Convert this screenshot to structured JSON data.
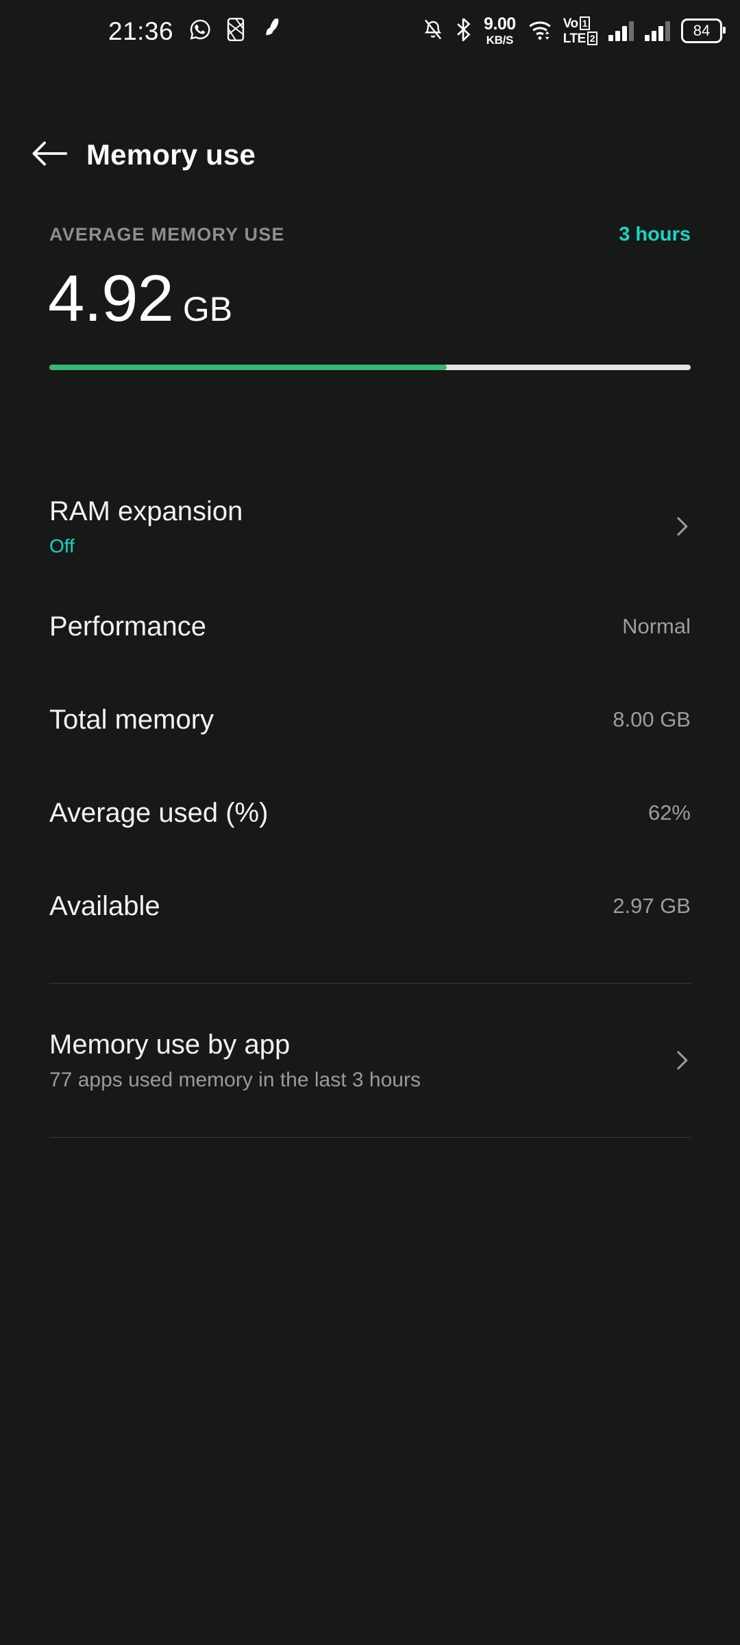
{
  "statusbar": {
    "time": "21:36",
    "left_icons": [
      "whatsapp-icon",
      "sim-card-icon",
      "location-rocket-icon"
    ],
    "right_icons": [
      "notifications-silenced-icon",
      "bluetooth-icon",
      "wifi-icon",
      "battery-icon"
    ],
    "network_speed": {
      "value": "9.00",
      "unit": "KB/S"
    },
    "volte": {
      "line1": "VoD",
      "line1_text": "Vo",
      "sim1": "1",
      "line2_text": "LTE",
      "sim2": "2"
    },
    "battery_level": "84"
  },
  "appbar": {
    "back_icon": "arrow-left-icon",
    "title": "Memory use"
  },
  "summary": {
    "label": "AVERAGE MEMORY USE",
    "period": "3 hours",
    "value": "4.92",
    "unit": "GB",
    "progress_percent": 62,
    "bar_fill_color": "#36b777",
    "bar_track_color": "#e4e4e4",
    "accent_color": "#16d6c4"
  },
  "list": {
    "ram_expansion": {
      "title": "RAM expansion",
      "subtitle": "Off",
      "chevron": "chevron-right-icon"
    },
    "details": [
      {
        "title": "Performance",
        "value": "Normal"
      },
      {
        "title": "Total memory",
        "value": "8.00 GB"
      },
      {
        "title": "Average used (%)",
        "value": "62%"
      },
      {
        "title": "Available",
        "value": "2.97 GB"
      }
    ],
    "memory_by_app": {
      "title": "Memory use by app",
      "subtitle": "77 apps used memory in the last 3 hours",
      "chevron": "chevron-right-icon"
    }
  }
}
